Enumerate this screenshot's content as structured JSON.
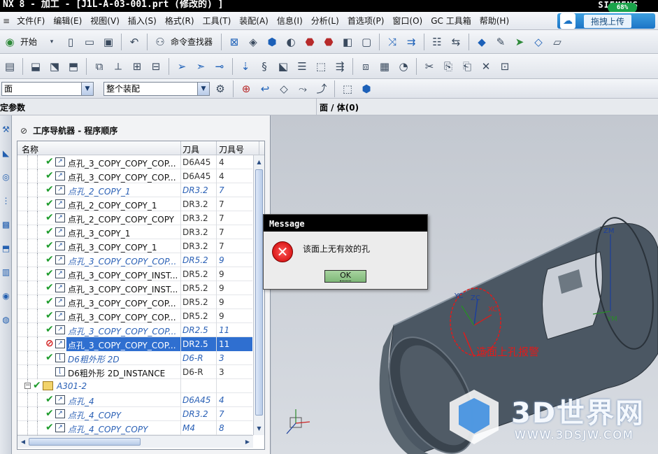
{
  "window": {
    "title": "NX 8 - 加工 - [J1L-A-03-001.prt  (修改的) ]",
    "brand": "SIEMENS",
    "brand_badge": "68%"
  },
  "menubar": {
    "items": [
      "文件(F)",
      "编辑(E)",
      "视图(V)",
      "插入(S)",
      "格式(R)",
      "工具(T)",
      "装配(A)",
      "信息(I)",
      "分析(L)",
      "首选项(P)",
      "窗口(O)",
      "GC 工具箱",
      "帮助(H)"
    ],
    "upload_label": "拖拽上传"
  },
  "toolbar1": {
    "start_label": "开始",
    "command_finder_label": "命令查找器"
  },
  "toolbar3": {
    "filter_value": "面",
    "assembly_scope_value": "整个装配"
  },
  "params": {
    "left_label": "定参数",
    "right_label": "面 / 体(0)"
  },
  "navigator": {
    "title": "工序导航器 - 程序顺序",
    "columns": [
      "名称",
      "刀具",
      "刀具号"
    ],
    "rows": [
      {
        "name": "点孔_3_COPY_COPY_COP...",
        "tool": "D6A45",
        "num": "4",
        "italic": false,
        "status": "ok",
        "type": "op"
      },
      {
        "name": "点孔_3_COPY_COPY_COP...",
        "tool": "D6A45",
        "num": "4",
        "italic": false,
        "status": "ok",
        "type": "op"
      },
      {
        "name": "点孔_2_COPY_1",
        "tool": "DR3.2",
        "num": "7",
        "italic": true,
        "status": "ok",
        "type": "op"
      },
      {
        "name": "点孔_2_COPY_COPY_1",
        "tool": "DR3.2",
        "num": "7",
        "italic": false,
        "status": "ok",
        "type": "op"
      },
      {
        "name": "点孔_2_COPY_COPY_COPY",
        "tool": "DR3.2",
        "num": "7",
        "italic": false,
        "status": "ok",
        "type": "op"
      },
      {
        "name": "点孔_3_COPY_1",
        "tool": "DR3.2",
        "num": "7",
        "italic": false,
        "status": "ok",
        "type": "op"
      },
      {
        "name": "点孔_3_COPY_COPY_1",
        "tool": "DR3.2",
        "num": "7",
        "italic": false,
        "status": "ok",
        "type": "op"
      },
      {
        "name": "点孔_3_COPY_COPY_COP...",
        "tool": "DR5.2",
        "num": "9",
        "italic": true,
        "status": "ok",
        "type": "op"
      },
      {
        "name": "点孔_3_COPY_COPY_INST...",
        "tool": "DR5.2",
        "num": "9",
        "italic": false,
        "status": "ok",
        "type": "op"
      },
      {
        "name": "点孔_3_COPY_COPY_INST...",
        "tool": "DR5.2",
        "num": "9",
        "italic": false,
        "status": "ok",
        "type": "op"
      },
      {
        "name": "点孔_3_COPY_COPY_COP...",
        "tool": "DR5.2",
        "num": "9",
        "italic": false,
        "status": "ok",
        "type": "op"
      },
      {
        "name": "点孔_3_COPY_COPY_COP...",
        "tool": "DR5.2",
        "num": "9",
        "italic": false,
        "status": "ok",
        "type": "op"
      },
      {
        "name": "点孔_3_COPY_COPY_COP...",
        "tool": "DR2.5",
        "num": "11",
        "italic": true,
        "status": "ok",
        "type": "op"
      },
      {
        "name": "点孔_3_COPY_COPY_COP...",
        "tool": "DR2.5",
        "num": "11",
        "italic": false,
        "status": "error",
        "type": "op",
        "selected": true
      },
      {
        "name": "D6粗外形 2D",
        "tool": "D6-R",
        "num": "3",
        "italic": true,
        "status": "ok",
        "type": "mill"
      },
      {
        "name": "D6粗外形 2D_INSTANCE",
        "tool": "D6-R",
        "num": "3",
        "italic": false,
        "status": "none",
        "type": "mill"
      },
      {
        "name": "A301-2",
        "tool": "",
        "num": "",
        "italic": true,
        "status": "ok",
        "type": "group"
      },
      {
        "name": "点孔_4",
        "tool": "D6A45",
        "num": "4",
        "italic": true,
        "status": "ok",
        "type": "op"
      },
      {
        "name": "点孔_4_COPY",
        "tool": "DR3.2",
        "num": "7",
        "italic": true,
        "status": "ok",
        "type": "op"
      },
      {
        "name": "点孔_4_COPY_COPY",
        "tool": "M4",
        "num": "8",
        "italic": true,
        "status": "ok",
        "type": "op"
      }
    ]
  },
  "viewport": {
    "annotation": "选面上孔报警",
    "axis_labels": {
      "xc": "XC",
      "yc": "YC",
      "zc": "ZC",
      "zm": "ZM",
      "ym": "YM"
    },
    "watermark_text": "3D世界网",
    "watermark_url": "WWW.3DSJW.COM"
  },
  "dialog": {
    "title": "Message",
    "message": "该面上无有效的孔",
    "ok_label": "OK"
  },
  "colors": {
    "selection": "#2f6fd0",
    "ok_check": "#1e9c2c",
    "error": "#d21c1c",
    "annotation": "#e21a1a"
  }
}
